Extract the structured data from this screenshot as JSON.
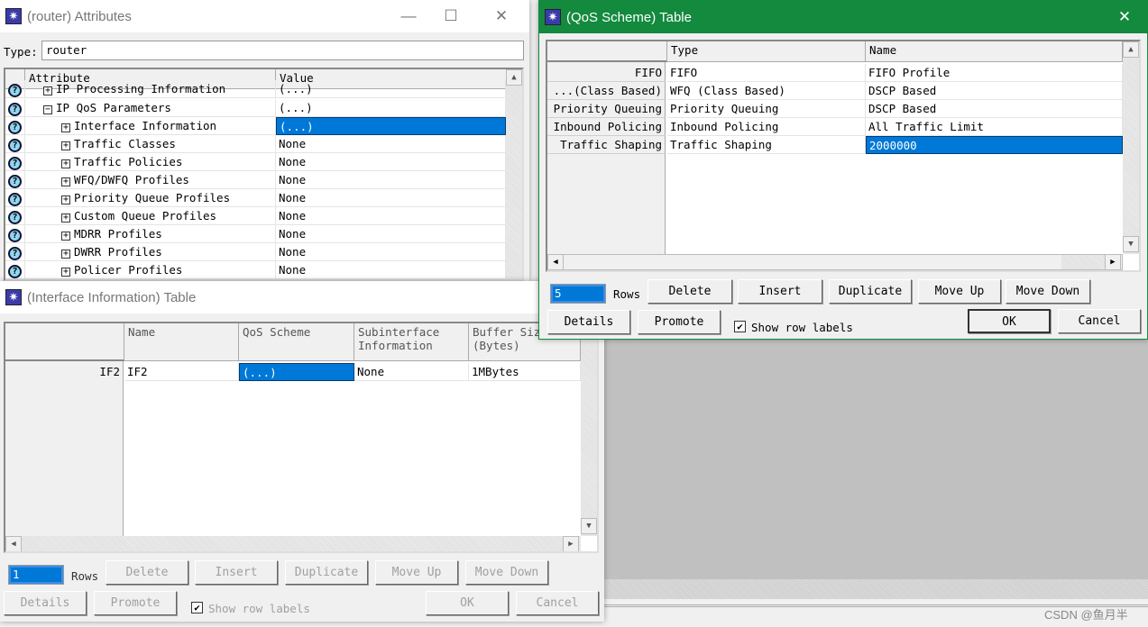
{
  "attributes_window": {
    "title": "(router) Attributes",
    "type_label": "Type:",
    "type_value": "router",
    "columns": [
      "Attribute",
      "Value"
    ],
    "rows": [
      {
        "attr": "IP Processing Information",
        "value": "(...)",
        "indent": 1,
        "toggle": "+",
        "partial": true
      },
      {
        "attr": "IP QoS Parameters",
        "value": "(...)",
        "indent": 1,
        "toggle": "-"
      },
      {
        "attr": "Interface Information",
        "value": "(...)",
        "indent": 2,
        "toggle": "+",
        "selected": true
      },
      {
        "attr": "Traffic Classes",
        "value": "None",
        "indent": 2,
        "toggle": "+"
      },
      {
        "attr": "Traffic Policies",
        "value": "None",
        "indent": 2,
        "toggle": "+"
      },
      {
        "attr": "WFQ/DWFQ Profiles",
        "value": "None",
        "indent": 2,
        "toggle": "+"
      },
      {
        "attr": "Priority Queue Profiles",
        "value": "None",
        "indent": 2,
        "toggle": "+"
      },
      {
        "attr": "Custom Queue Profiles",
        "value": "None",
        "indent": 2,
        "toggle": "+"
      },
      {
        "attr": "MDRR Profiles",
        "value": "None",
        "indent": 2,
        "toggle": "+"
      },
      {
        "attr": "DWRR Profiles",
        "value": "None",
        "indent": 2,
        "toggle": "+"
      },
      {
        "attr": "Policer Profiles",
        "value": "None",
        "indent": 2,
        "toggle": "+"
      }
    ]
  },
  "qos_window": {
    "title": "(QoS Scheme) Table",
    "columns": [
      "Type",
      "Name"
    ],
    "rows": [
      {
        "label": "FIFO",
        "type": "FIFO",
        "name": "FIFO Profile"
      },
      {
        "label": "...(Class Based)",
        "type": "WFQ (Class Based)",
        "name": "DSCP Based"
      },
      {
        "label": "Priority Queuing",
        "type": "Priority Queuing",
        "name": "DSCP Based"
      },
      {
        "label": "Inbound Policing",
        "type": "Inbound Policing",
        "name": "All Traffic Limit"
      },
      {
        "label": "Traffic Shaping",
        "type": "Traffic Shaping",
        "name": "2000000",
        "selected": true
      }
    ],
    "rows_count": "5",
    "rows_label": "Rows",
    "buttons": {
      "delete": "Delete",
      "insert": "Insert",
      "duplicate": "Duplicate",
      "move_up": "Move Up",
      "move_down": "Move Down",
      "details": "Details",
      "promote": "Promote",
      "ok": "OK",
      "cancel": "Cancel"
    },
    "show_row_labels": "Show row labels",
    "show_row_labels_checked": true
  },
  "iface_window": {
    "title": "(Interface Information) Table",
    "columns": [
      "Name",
      "QoS Scheme",
      "Subinterface\nInformation",
      "Buffer Size\n(Bytes)"
    ],
    "rows": [
      {
        "label": "IF2",
        "cells": [
          "IF2",
          "(...)",
          "None",
          "1MBytes"
        ]
      }
    ],
    "rows_count": "1",
    "rows_label": "Rows",
    "buttons": {
      "delete": "Delete",
      "insert": "Insert",
      "duplicate": "Duplicate",
      "move_up": "Move Up",
      "move_down": "Move Down",
      "details": "Details",
      "promote": "Promote",
      "ok": "OK",
      "cancel": "Cancel"
    },
    "show_row_labels": "Show row labels",
    "show_row_labels_checked": true
  },
  "watermark": "CSDN @鱼月半",
  "colors": {
    "active_title": "#138a3e",
    "selection": "#0078d7",
    "desktop": "#c0c0c0"
  }
}
